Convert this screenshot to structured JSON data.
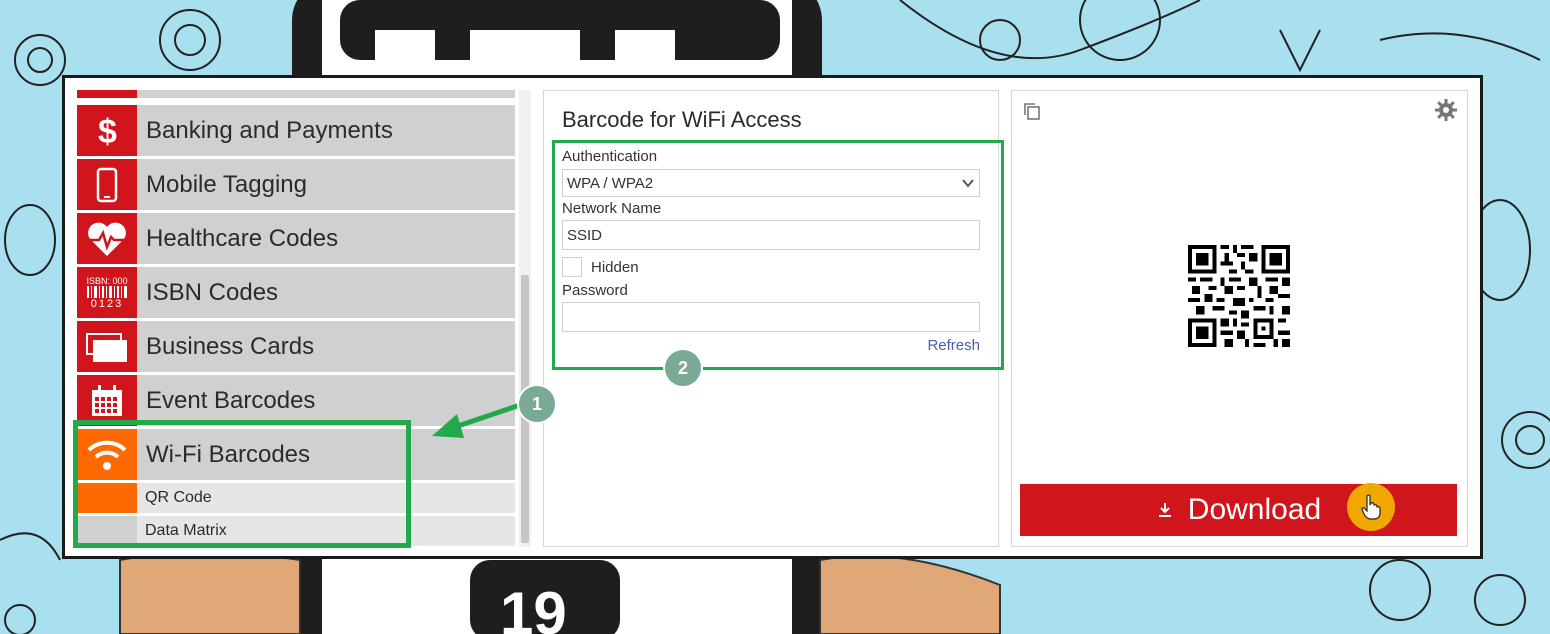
{
  "sidebar": {
    "items": [
      {
        "label": "Banking and Payments",
        "icon": "dollar-icon"
      },
      {
        "label": "Mobile Tagging",
        "icon": "mobile-phone-icon"
      },
      {
        "label": "Healthcare Codes",
        "icon": "heart-pulse-icon"
      },
      {
        "label": "ISBN Codes",
        "icon": "isbn-barcode-icon",
        "icon_text_top": "ISBN: 000",
        "icon_text_bottom": "0123"
      },
      {
        "label": "Business Cards",
        "icon": "business-card-icon"
      },
      {
        "label": "Event Barcodes",
        "icon": "calendar-icon"
      },
      {
        "label": "Wi-Fi Barcodes",
        "icon": "wifi-icon",
        "active": true
      }
    ],
    "sub_items": [
      {
        "label": "QR Code",
        "selected": true
      },
      {
        "label": "Data Matrix",
        "selected": false
      }
    ]
  },
  "form": {
    "title": "Barcode for WiFi Access",
    "authentication_label": "Authentication",
    "authentication_value": "WPA / WPA2",
    "network_name_label": "Network Name",
    "network_name_value": "SSID",
    "hidden_label": "Hidden",
    "hidden_checked": false,
    "password_label": "Password",
    "password_value": "",
    "refresh_label": "Refresh"
  },
  "preview": {
    "download_label": "Download"
  },
  "annotations": {
    "step1": "1",
    "step2": "2"
  },
  "colors": {
    "category_red": "#d0151c",
    "active_orange": "#ff6a00",
    "highlight_green": "#22a94b",
    "download_red": "#d0151c",
    "cursor_yellow": "#f0a800",
    "link_blue": "#4a5db0"
  }
}
